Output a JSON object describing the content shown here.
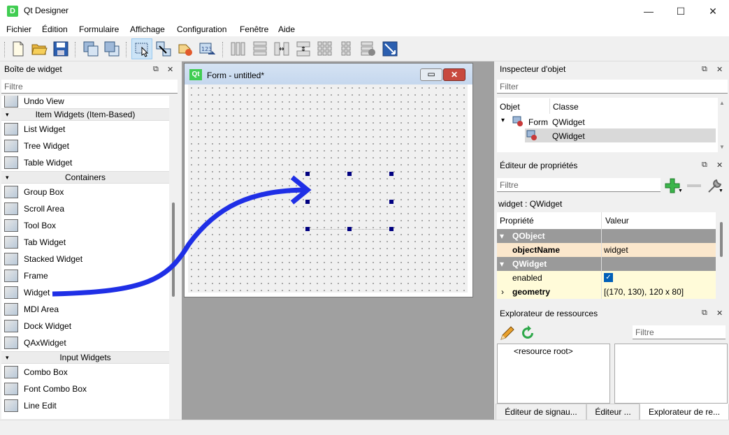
{
  "window": {
    "title": "Qt Designer",
    "app_icon": "D",
    "minimize": "—",
    "maximize": "☐",
    "close": "✕"
  },
  "menu": [
    "Fichier",
    "Édition",
    "Formulaire",
    "Affichage",
    "Configuration",
    "Fenêtre",
    "Aide"
  ],
  "toolbar_icons": [
    "new-file-icon",
    "open-folder-icon",
    "save-icon",
    "send-to-back-icon",
    "bring-to-front-icon",
    "edit-widgets-icon",
    "edit-signals-slots-icon",
    "edit-buddies-icon",
    "edit-tab-order-icon",
    "layout-horizontal-icon",
    "layout-vertical-icon",
    "layout-horizontal-splitter-icon",
    "layout-vertical-splitter-icon",
    "layout-grid-icon",
    "layout-form-icon",
    "break-layout-icon",
    "adjust-size-icon"
  ],
  "widget_box": {
    "title": "Boîte de widget",
    "filter_placeholder": "Filtre",
    "rows": [
      {
        "kind": "item",
        "label": "Undo View",
        "icon": "undo-view-icon"
      },
      {
        "kind": "cat",
        "label": "Item Widgets (Item-Based)"
      },
      {
        "kind": "item",
        "label": "List Widget",
        "icon": "list-widget-icon"
      },
      {
        "kind": "item",
        "label": "Tree Widget",
        "icon": "tree-widget-icon"
      },
      {
        "kind": "item",
        "label": "Table Widget",
        "icon": "table-widget-icon"
      },
      {
        "kind": "cat",
        "label": "Containers"
      },
      {
        "kind": "item",
        "label": "Group Box",
        "icon": "group-box-icon"
      },
      {
        "kind": "item",
        "label": "Scroll Area",
        "icon": "scroll-area-icon"
      },
      {
        "kind": "item",
        "label": "Tool Box",
        "icon": "tool-box-icon"
      },
      {
        "kind": "item",
        "label": "Tab Widget",
        "icon": "tab-widget-icon"
      },
      {
        "kind": "item",
        "label": "Stacked Widget",
        "icon": "stacked-widget-icon"
      },
      {
        "kind": "item",
        "label": "Frame",
        "icon": "frame-icon"
      },
      {
        "kind": "item",
        "label": "Widget",
        "icon": "widget-icon"
      },
      {
        "kind": "item",
        "label": "MDI Area",
        "icon": "mdi-area-icon"
      },
      {
        "kind": "item",
        "label": "Dock Widget",
        "icon": "dock-widget-icon"
      },
      {
        "kind": "item",
        "label": "QAxWidget",
        "icon": "qaxwidget-icon"
      },
      {
        "kind": "cat",
        "label": "Input Widgets"
      },
      {
        "kind": "item",
        "label": "Combo Box",
        "icon": "combo-box-icon"
      },
      {
        "kind": "item",
        "label": "Font Combo Box",
        "icon": "font-combo-box-icon"
      },
      {
        "kind": "item",
        "label": "Line Edit",
        "icon": "line-edit-icon"
      }
    ]
  },
  "form": {
    "title": "Form - untitled*",
    "icon": "Qt",
    "min": "▭",
    "close": "✕"
  },
  "object_inspector": {
    "title": "Inspecteur d'objet",
    "filter_placeholder": "Filter",
    "col_object": "Objet",
    "col_class": "Classe",
    "rows": [
      {
        "object": "Form",
        "class": "QWidget"
      },
      {
        "object": "",
        "class": "QWidget"
      }
    ]
  },
  "property_editor": {
    "title": "Éditeur de propriétés",
    "filter_placeholder": "Filtre",
    "context": "widget : QWidget",
    "col_prop": "Propriété",
    "col_value": "Valeur",
    "rows": [
      {
        "kind": "group",
        "label": "QObject"
      },
      {
        "kind": "prop",
        "label": "objectName",
        "value": "widget"
      },
      {
        "kind": "group",
        "label": "QWidget"
      },
      {
        "kind": "prop",
        "label": "enabled",
        "value": ""
      },
      {
        "kind": "prop",
        "label": "geometry",
        "value": "[(170, 130), 120 x 80]"
      }
    ]
  },
  "resource_explorer": {
    "title": "Explorateur de ressources",
    "filter_placeholder": "Filtre",
    "root": "<resource root>"
  },
  "bottom_tabs": [
    "Éditeur de signau...",
    "Éditeur ...",
    "Explorateur de re..."
  ],
  "colors": {
    "arrow": "#1f2fe6",
    "selection": "#cde8ff",
    "prop_highlight": "#fff2cc",
    "group_bg": "#9a9a9a"
  }
}
